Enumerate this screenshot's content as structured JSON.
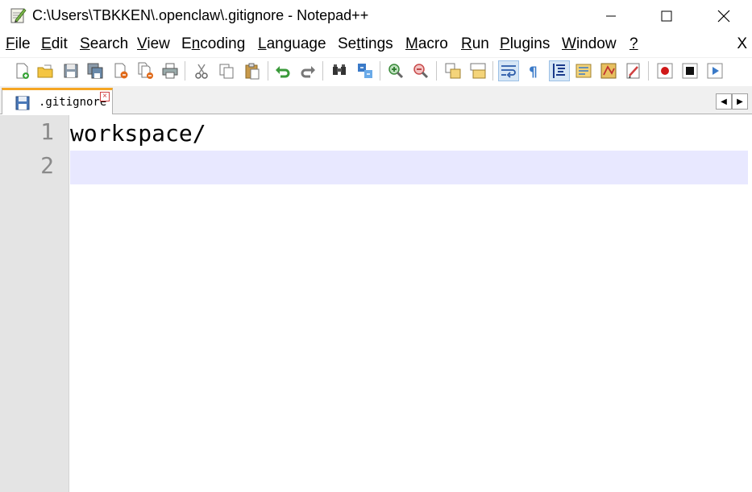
{
  "window": {
    "title": "C:\\Users\\TBKKEN\\.openclaw\\.gitignore - Notepad++",
    "icon": "notepad-plus-plus-icon"
  },
  "menu": {
    "items": [
      {
        "label": "File",
        "accel": "F",
        "rest": "ile"
      },
      {
        "label": "Edit",
        "accel": "E",
        "rest": "dit"
      },
      {
        "label": "Search",
        "accel": "S",
        "rest": "earch"
      },
      {
        "label": "View",
        "accel": "V",
        "rest": "iew"
      },
      {
        "label": "Encoding",
        "accel": "",
        "pre": "E",
        "accel2": "n",
        "rest": "coding"
      },
      {
        "label": "Language",
        "accel": "L",
        "rest": "anguage"
      },
      {
        "label": "Settings",
        "accel": "",
        "pre": "Se",
        "accel2": "t",
        "rest": "tings"
      },
      {
        "label": "Macro",
        "accel": "M",
        "rest": "acro"
      },
      {
        "label": "Run",
        "accel": "R",
        "rest": "un"
      },
      {
        "label": "Plugins",
        "accel": "P",
        "rest": "lugins"
      },
      {
        "label": "Window",
        "accel": "W",
        "rest": "indow"
      },
      {
        "label": "?",
        "accel": "?",
        "rest": ""
      }
    ],
    "close_label": "X"
  },
  "toolbar": {
    "buttons": [
      "new-file-icon",
      "open-file-icon",
      "save-icon",
      "save-all-icon",
      "close-icon",
      "close-all-icon",
      "print-icon",
      "cut-icon",
      "copy-icon",
      "paste-icon",
      "undo-icon",
      "redo-icon",
      "find-icon",
      "replace-icon",
      "zoom-in-icon",
      "zoom-out-icon",
      "sync-vertical-icon",
      "sync-horizontal-icon",
      "word-wrap-icon",
      "show-all-characters-icon",
      "indent-guide-icon",
      "document-map-icon",
      "function-list-icon",
      "folder-as-workspace-icon",
      "record-macro-icon",
      "stop-recording-icon",
      "play-macro-icon"
    ]
  },
  "tabs": [
    {
      "label": ".gitignore",
      "icon": "saved-file-icon",
      "active": true,
      "close": "×"
    }
  ],
  "tab_scroll": {
    "left": "◀",
    "right": "▶"
  },
  "editor": {
    "lines": [
      {
        "number": "1",
        "text": "workspace/"
      },
      {
        "number": "2",
        "text": ""
      }
    ],
    "current_line": 2
  },
  "colors": {
    "current_line_highlight": "#e8e8ff",
    "gutter": "#e4e4e4",
    "tab_accent": "#f5a623"
  }
}
